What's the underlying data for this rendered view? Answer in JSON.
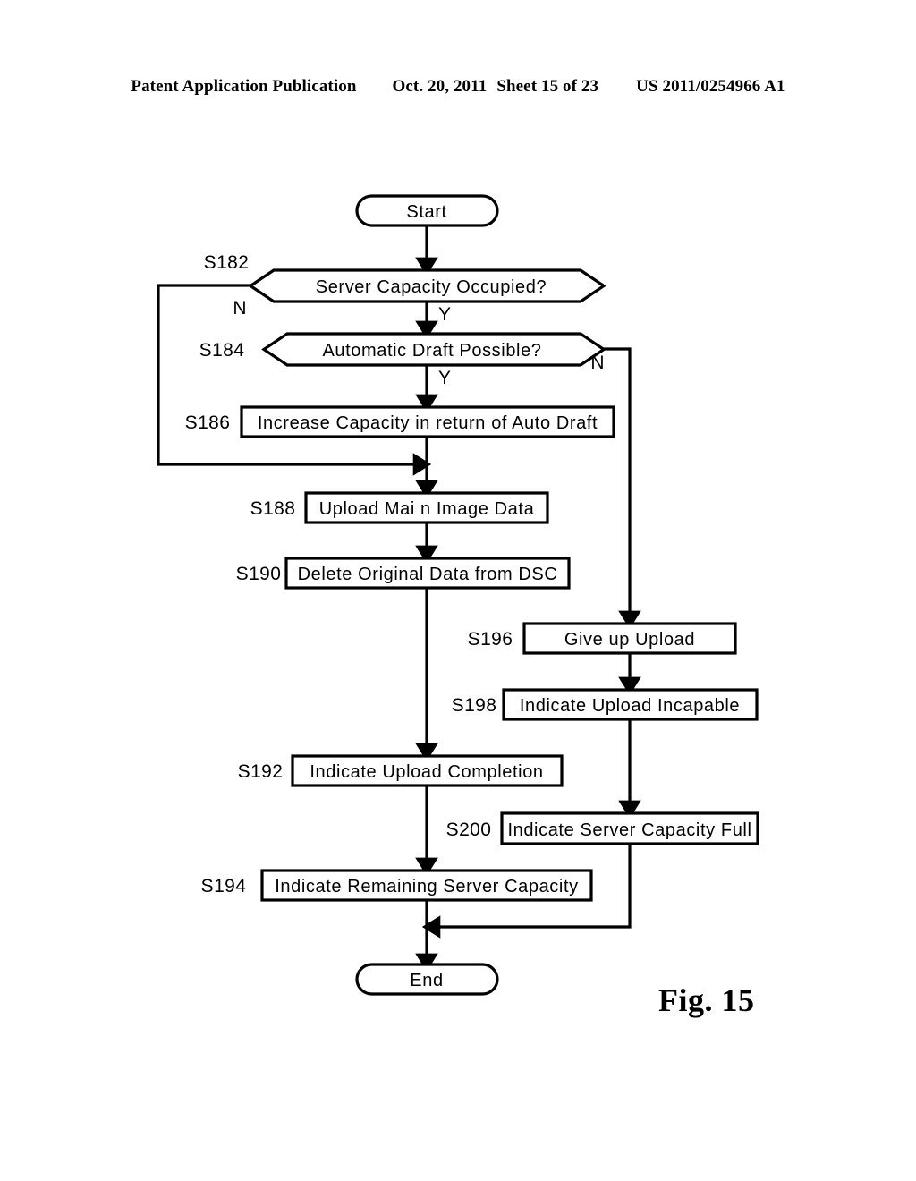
{
  "header": {
    "publication": "Patent Application Publication",
    "date": "Oct. 20, 2011",
    "sheet": "Sheet 15 of 23",
    "patent_number": "US 2011/0254966 A1"
  },
  "figure": {
    "caption": "Fig. 15"
  },
  "chart_data": {
    "type": "diagram",
    "diagram_type": "flowchart",
    "title": "Fig. 15",
    "nodes": [
      {
        "id": "start",
        "step": "",
        "shape": "terminator",
        "label": "Start"
      },
      {
        "id": "s182",
        "step": "S182",
        "shape": "decision",
        "label": "Server Capacity Occupied?"
      },
      {
        "id": "s184",
        "step": "S184",
        "shape": "decision",
        "label": "Automatic Draft Possible?"
      },
      {
        "id": "s186",
        "step": "S186",
        "shape": "process",
        "label": "Increase Capacity in return of Auto Draft"
      },
      {
        "id": "s188",
        "step": "S188",
        "shape": "process",
        "label": "Upload Mai n Image Data"
      },
      {
        "id": "s190",
        "step": "S190",
        "shape": "process",
        "label": "Delete Original Data from DSC"
      },
      {
        "id": "s196",
        "step": "S196",
        "shape": "process",
        "label": "Give up Upload"
      },
      {
        "id": "s198",
        "step": "S198",
        "shape": "process",
        "label": "Indicate Upload Incapable"
      },
      {
        "id": "s192",
        "step": "S192",
        "shape": "process",
        "label": "Indicate Upload Completion"
      },
      {
        "id": "s200",
        "step": "S200",
        "shape": "process",
        "label": "Indicate Server Capacity Full"
      },
      {
        "id": "s194",
        "step": "S194",
        "shape": "process",
        "label": "Indicate Remaining Server Capacity"
      },
      {
        "id": "end",
        "step": "",
        "shape": "terminator",
        "label": "End"
      }
    ],
    "edges": [
      {
        "from": "start",
        "to": "s182",
        "label": ""
      },
      {
        "from": "s182",
        "to": "s184",
        "label": "Y"
      },
      {
        "from": "s182",
        "to": "s188",
        "label": "N"
      },
      {
        "from": "s184",
        "to": "s186",
        "label": "Y"
      },
      {
        "from": "s184",
        "to": "s196",
        "label": "N"
      },
      {
        "from": "s186",
        "to": "s188",
        "label": ""
      },
      {
        "from": "s188",
        "to": "s190",
        "label": ""
      },
      {
        "from": "s190",
        "to": "s192",
        "label": ""
      },
      {
        "from": "s192",
        "to": "s194",
        "label": ""
      },
      {
        "from": "s194",
        "to": "end",
        "label": ""
      },
      {
        "from": "s196",
        "to": "s198",
        "label": ""
      },
      {
        "from": "s198",
        "to": "s200",
        "label": ""
      },
      {
        "from": "s200",
        "to": "end",
        "label": ""
      }
    ],
    "branch_labels": {
      "s182_no": "N",
      "s182_yes": "Y",
      "s184_yes": "Y",
      "s184_no": "N"
    },
    "colors": {
      "stroke": "#000000",
      "fill": "#ffffff",
      "text": "#000000"
    }
  }
}
